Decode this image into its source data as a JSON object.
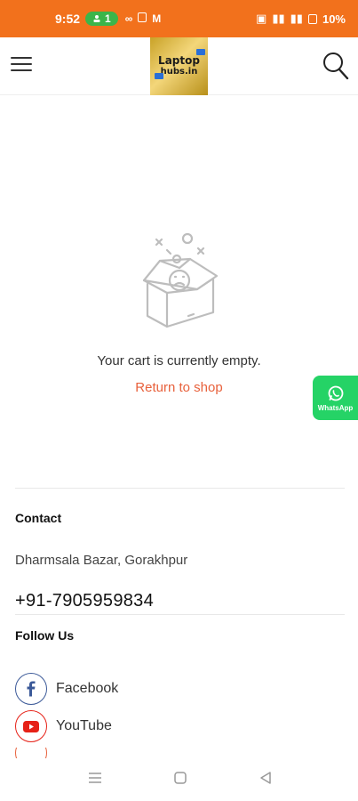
{
  "status_bar": {
    "time": "9:52",
    "pill_count": "1",
    "battery": "10%"
  },
  "header": {
    "logo_line1": "Laptop",
    "logo_line2": "hubs.in"
  },
  "cart": {
    "empty_message": "Your cart is currently empty.",
    "return_link": "Return to shop"
  },
  "whatsapp": {
    "label": "WhatsApp"
  },
  "footer": {
    "contact_heading": "Contact",
    "address": "Dharmsala Bazar, Gorakhpur",
    "phone": "+91-7905959834",
    "follow_heading": "Follow Us",
    "social": [
      {
        "label": "Facebook",
        "icon": "facebook-icon",
        "color": "#3b5998"
      },
      {
        "label": "YouTube",
        "icon": "youtube-icon",
        "color": "#e62117"
      }
    ]
  },
  "colors": {
    "status_bar": "#f2711c",
    "accent_link": "#e8613c",
    "whatsapp": "#25d366"
  }
}
